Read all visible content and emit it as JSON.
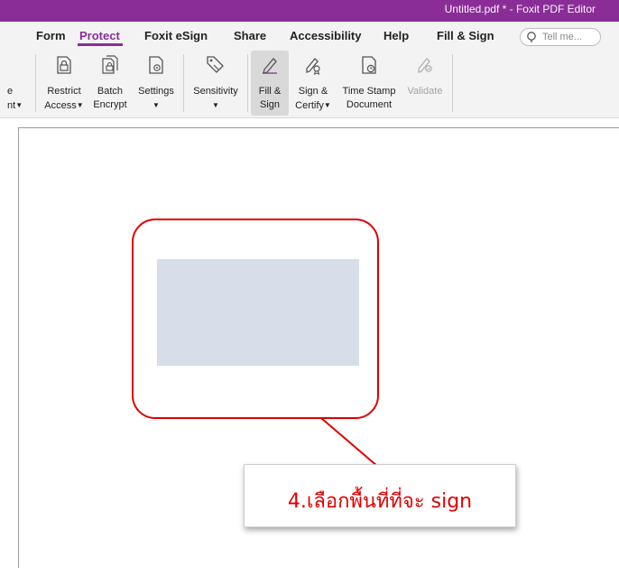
{
  "window": {
    "title": "Untitled.pdf * - Foxit PDF Editor"
  },
  "tabs": [
    {
      "label": "Form"
    },
    {
      "label": "Protect"
    },
    {
      "label": "Foxit eSign"
    },
    {
      "label": "Share"
    },
    {
      "label": "Accessibility"
    },
    {
      "label": "Help"
    },
    {
      "label": "Fill & Sign"
    }
  ],
  "active_tab": "Protect",
  "search": {
    "placeholder": "Tell me..."
  },
  "ribbon": {
    "partial_left": {
      "line1": "e",
      "line2": "nt"
    },
    "restrict_access": {
      "line1": "Restrict",
      "line2": "Access"
    },
    "batch_encrypt": {
      "line1": "Batch",
      "line2": "Encrypt"
    },
    "settings": {
      "line1": "Settings"
    },
    "sensitivity": {
      "line1": "Sensitivity"
    },
    "fill_sign": {
      "line1": "Fill &",
      "line2": "Sign"
    },
    "sign_certify": {
      "line1": "Sign &",
      "line2": "Certify"
    },
    "time_stamp": {
      "line1": "Time Stamp",
      "line2": "Document"
    },
    "validate": {
      "line1": "Validate"
    }
  },
  "callout": {
    "text": "4.เลือกพื้นที่ที่จะ sign"
  },
  "colors": {
    "brand": "#8a2d97",
    "annotation_red": "#e00000",
    "signature_area": "#d7deea"
  },
  "icons": [
    "lock-doc-icon",
    "encrypt-doc-icon",
    "settings-doc-icon",
    "sensitivity-tag-icon",
    "pen-icon",
    "sign-certify-icon",
    "time-stamp-icon",
    "validate-icon",
    "search-icon"
  ]
}
